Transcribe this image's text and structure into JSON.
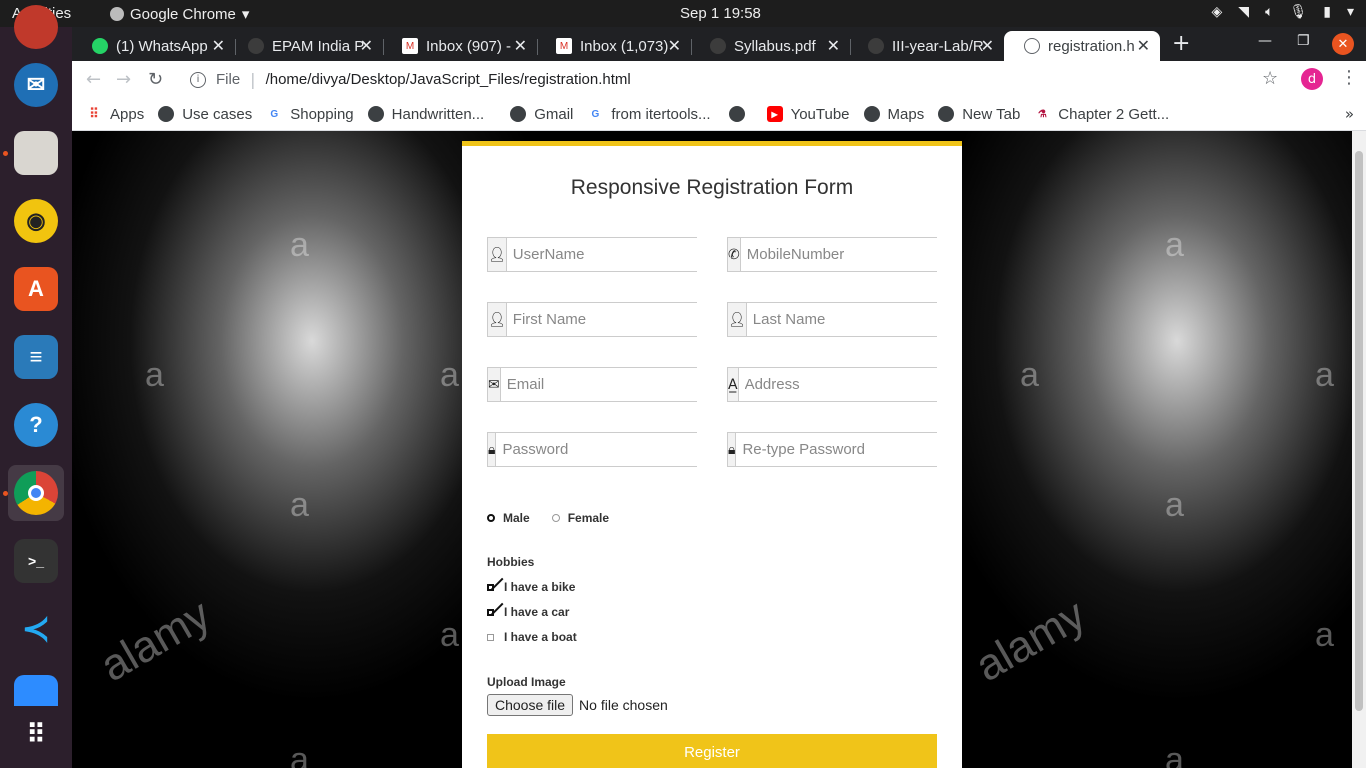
{
  "topbar": {
    "activities": "Activities",
    "app_name": "Google Chrome",
    "clock": "Sep 1  19:58"
  },
  "tabs": [
    {
      "title": "(1) WhatsApp",
      "icon": "whatsapp-icon",
      "color": "#25d366"
    },
    {
      "title": "EPAM India P",
      "icon": "globe-icon",
      "color": "#5f6368"
    },
    {
      "title": "Inbox (907) -",
      "icon": "gmail-icon",
      "color": "#d93025"
    },
    {
      "title": "Inbox (1,073)",
      "icon": "gmail-icon",
      "color": "#d93025"
    },
    {
      "title": "Syllabus.pdf",
      "icon": "globe-icon",
      "color": "#5f6368"
    },
    {
      "title": "III-year-Lab/R",
      "icon": "github-icon",
      "color": "#5f6368"
    },
    {
      "title": "registration.h",
      "icon": "globe-icon",
      "color": "#5f6368",
      "active": true
    }
  ],
  "toolbar": {
    "scheme": "File",
    "url": "/home/divya/Desktop/JavaScript_Files/registration.html",
    "avatar_letter": "d"
  },
  "bookmarks": [
    {
      "label": "Apps",
      "icon": "apps-grid-icon"
    },
    {
      "label": "Use cases",
      "icon": "globe-icon"
    },
    {
      "label": "Shopping",
      "icon": "google-icon"
    },
    {
      "label": "Handwritten...",
      "icon": "globe-icon"
    },
    {
      "label": "Gmail",
      "icon": "globe-icon"
    },
    {
      "label": "from itertools...",
      "icon": "google-icon"
    },
    {
      "label": "",
      "icon": "globe-icon"
    },
    {
      "label": "YouTube",
      "icon": "youtube-icon"
    },
    {
      "label": "Maps",
      "icon": "globe-icon"
    },
    {
      "label": "New Tab",
      "icon": "globe-icon"
    },
    {
      "label": "Chapter 2 Gett...",
      "icon": "bookmark-doc-icon"
    }
  ],
  "form": {
    "title": "Responsive Registration Form",
    "fields": {
      "username": {
        "placeholder": "UserName",
        "icon": "user-icon"
      },
      "mobile": {
        "placeholder": "MobileNumber",
        "icon": "phone-icon"
      },
      "firstname": {
        "placeholder": "First Name",
        "icon": "user-icon"
      },
      "lastname": {
        "placeholder": "Last Name",
        "icon": "user-icon"
      },
      "email": {
        "placeholder": "Email",
        "icon": "envelope-icon"
      },
      "address": {
        "placeholder": "Address",
        "icon": "address-icon"
      },
      "password": {
        "placeholder": "Password",
        "icon": "lock-icon"
      },
      "repassword": {
        "placeholder": "Re-type Password",
        "icon": "lock-icon"
      }
    },
    "gender": {
      "male": "Male",
      "female": "Female",
      "selected": "Male"
    },
    "hobbies_label": "Hobbies",
    "hobbies": [
      {
        "label": "I have a bike",
        "checked": true
      },
      {
        "label": "I have a car",
        "checked": true
      },
      {
        "label": "I have a boat",
        "checked": false
      }
    ],
    "upload_label": "Upload Image",
    "choose_file": "Choose file",
    "no_file": "No file chosen",
    "register": "Register"
  },
  "watermarks": {
    "letter": "a",
    "brand": "alamy"
  },
  "colors": {
    "accent": "#f0c419",
    "dock_bg": "#2c1f2c",
    "tabstrip_bg": "#202124"
  }
}
